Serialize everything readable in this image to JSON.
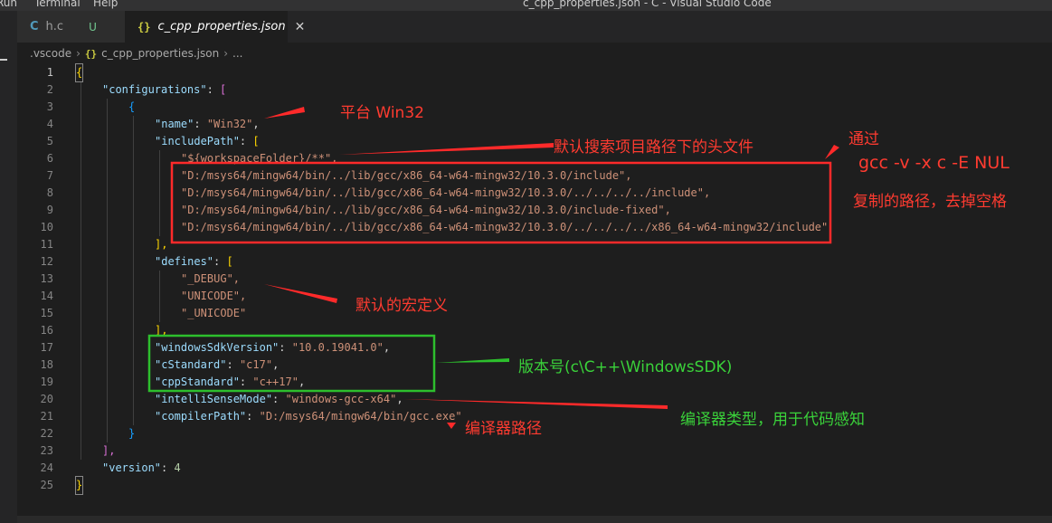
{
  "window": {
    "menu_items": [
      "Run",
      "Terminal",
      "Help"
    ],
    "title": "c_cpp_properties.json - C - Visual Studio Code"
  },
  "tabs": [
    {
      "label": "h.c",
      "icon": "c-file-icon",
      "badge": "",
      "active": false
    },
    {
      "label": "",
      "icon": "",
      "badge": "U",
      "active": false
    },
    {
      "label": "c_cpp_properties.json",
      "icon": "json-file-icon",
      "badge": "",
      "active": true
    }
  ],
  "breadcrumb": {
    "folder": ".vscode",
    "file": "c_cpp_properties.json",
    "more": "..."
  },
  "code": {
    "lines": [
      {
        "n": "1",
        "text": "{"
      },
      {
        "n": "2",
        "text": "\"configurations\": ["
      },
      {
        "n": "3",
        "text": "{"
      },
      {
        "n": "4",
        "text": "\"name\": \"Win32\","
      },
      {
        "n": "5",
        "text": "\"includePath\": ["
      },
      {
        "n": "6",
        "text": "\"${workspaceFolder}/**\","
      },
      {
        "n": "7",
        "text": "\"D:/msys64/mingw64/bin/../lib/gcc/x86_64-w64-mingw32/10.3.0/include\","
      },
      {
        "n": "8",
        "text": "\"D:/msys64/mingw64/bin/../lib/gcc/x86_64-w64-mingw32/10.3.0/../../../../include\","
      },
      {
        "n": "9",
        "text": "\"D:/msys64/mingw64/bin/../lib/gcc/x86_64-w64-mingw32/10.3.0/include-fixed\","
      },
      {
        "n": "10",
        "text": "\"D:/msys64/mingw64/bin/../lib/gcc/x86_64-w64-mingw32/10.3.0/../../../../x86_64-w64-mingw32/include\""
      },
      {
        "n": "11",
        "text": "],"
      },
      {
        "n": "12",
        "text": "\"defines\": ["
      },
      {
        "n": "13",
        "text": "\"_DEBUG\","
      },
      {
        "n": "14",
        "text": "\"UNICODE\","
      },
      {
        "n": "15",
        "text": "\"_UNICODE\""
      },
      {
        "n": "16",
        "text": "],"
      },
      {
        "n": "17",
        "text": "\"windowsSdkVersion\": \"10.0.19041.0\","
      },
      {
        "n": "18",
        "text": "\"cStandard\": \"c17\","
      },
      {
        "n": "19",
        "text": "\"cppStandard\": \"c++17\","
      },
      {
        "n": "20",
        "text": "\"intelliSenseMode\": \"windows-gcc-x64\","
      },
      {
        "n": "21",
        "text": "\"compilerPath\": \"D:/msys64/mingw64/bin/gcc.exe\""
      },
      {
        "n": "22",
        "text": "}"
      },
      {
        "n": "23",
        "text": "],"
      },
      {
        "n": "24",
        "text": "\"version\": 4"
      },
      {
        "n": "25",
        "text": "}"
      }
    ]
  },
  "annotations": {
    "platform": "平台 Win32",
    "default_include": "默认搜索项目路径下的头文件",
    "via_line1": "通过",
    "via_line2": "gcc -v -x c -E NUL",
    "via_line3": "复制的路径，去掉空格",
    "default_macros": "默认的宏定义",
    "version_note": "版本号(c\\C++\\WindowsSDK)",
    "intellisense_note": "编译器类型，用于代码感知",
    "compiler_path_note": "编译器路径"
  },
  "colors": {
    "annotation_red": "#ff3b30",
    "annotation_green": "#3ad23a",
    "editor_background": "#1e1e1e"
  }
}
